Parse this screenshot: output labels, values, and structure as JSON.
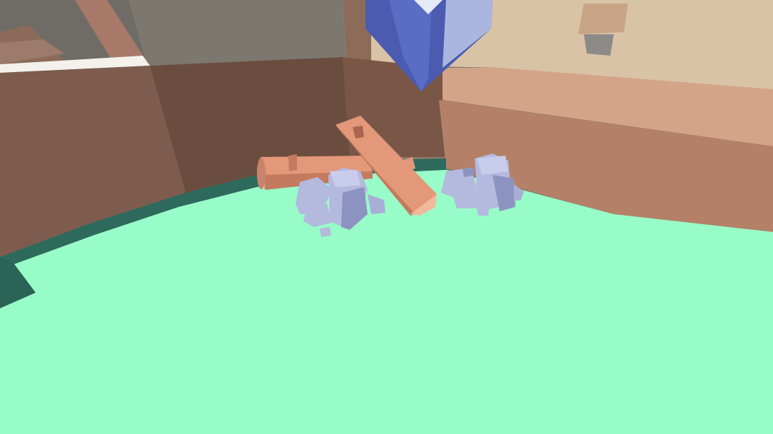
{
  "scene": {
    "colors": {
      "sky_left": "#7a766e",
      "wall_left": "#7d5c4e",
      "wall_left_dark": "#6b4d40",
      "wall_back": "#8a6a5a",
      "wall_right": "#b98a70",
      "wall_right_top": "#d6b79a",
      "ledge_white": "#f4f1ec",
      "floor": "#98fcc8",
      "floor_shadow": "#2d6a5c",
      "log": "#e3987a",
      "log_dark": "#c47a5e",
      "log_end": "#f0b89c",
      "rock": "#b4b9de",
      "rock_dark": "#8d93c0",
      "rock_light": "#c9cdec",
      "banner_blue": "#4a5bb0",
      "banner_light": "#aab6e0"
    }
  }
}
